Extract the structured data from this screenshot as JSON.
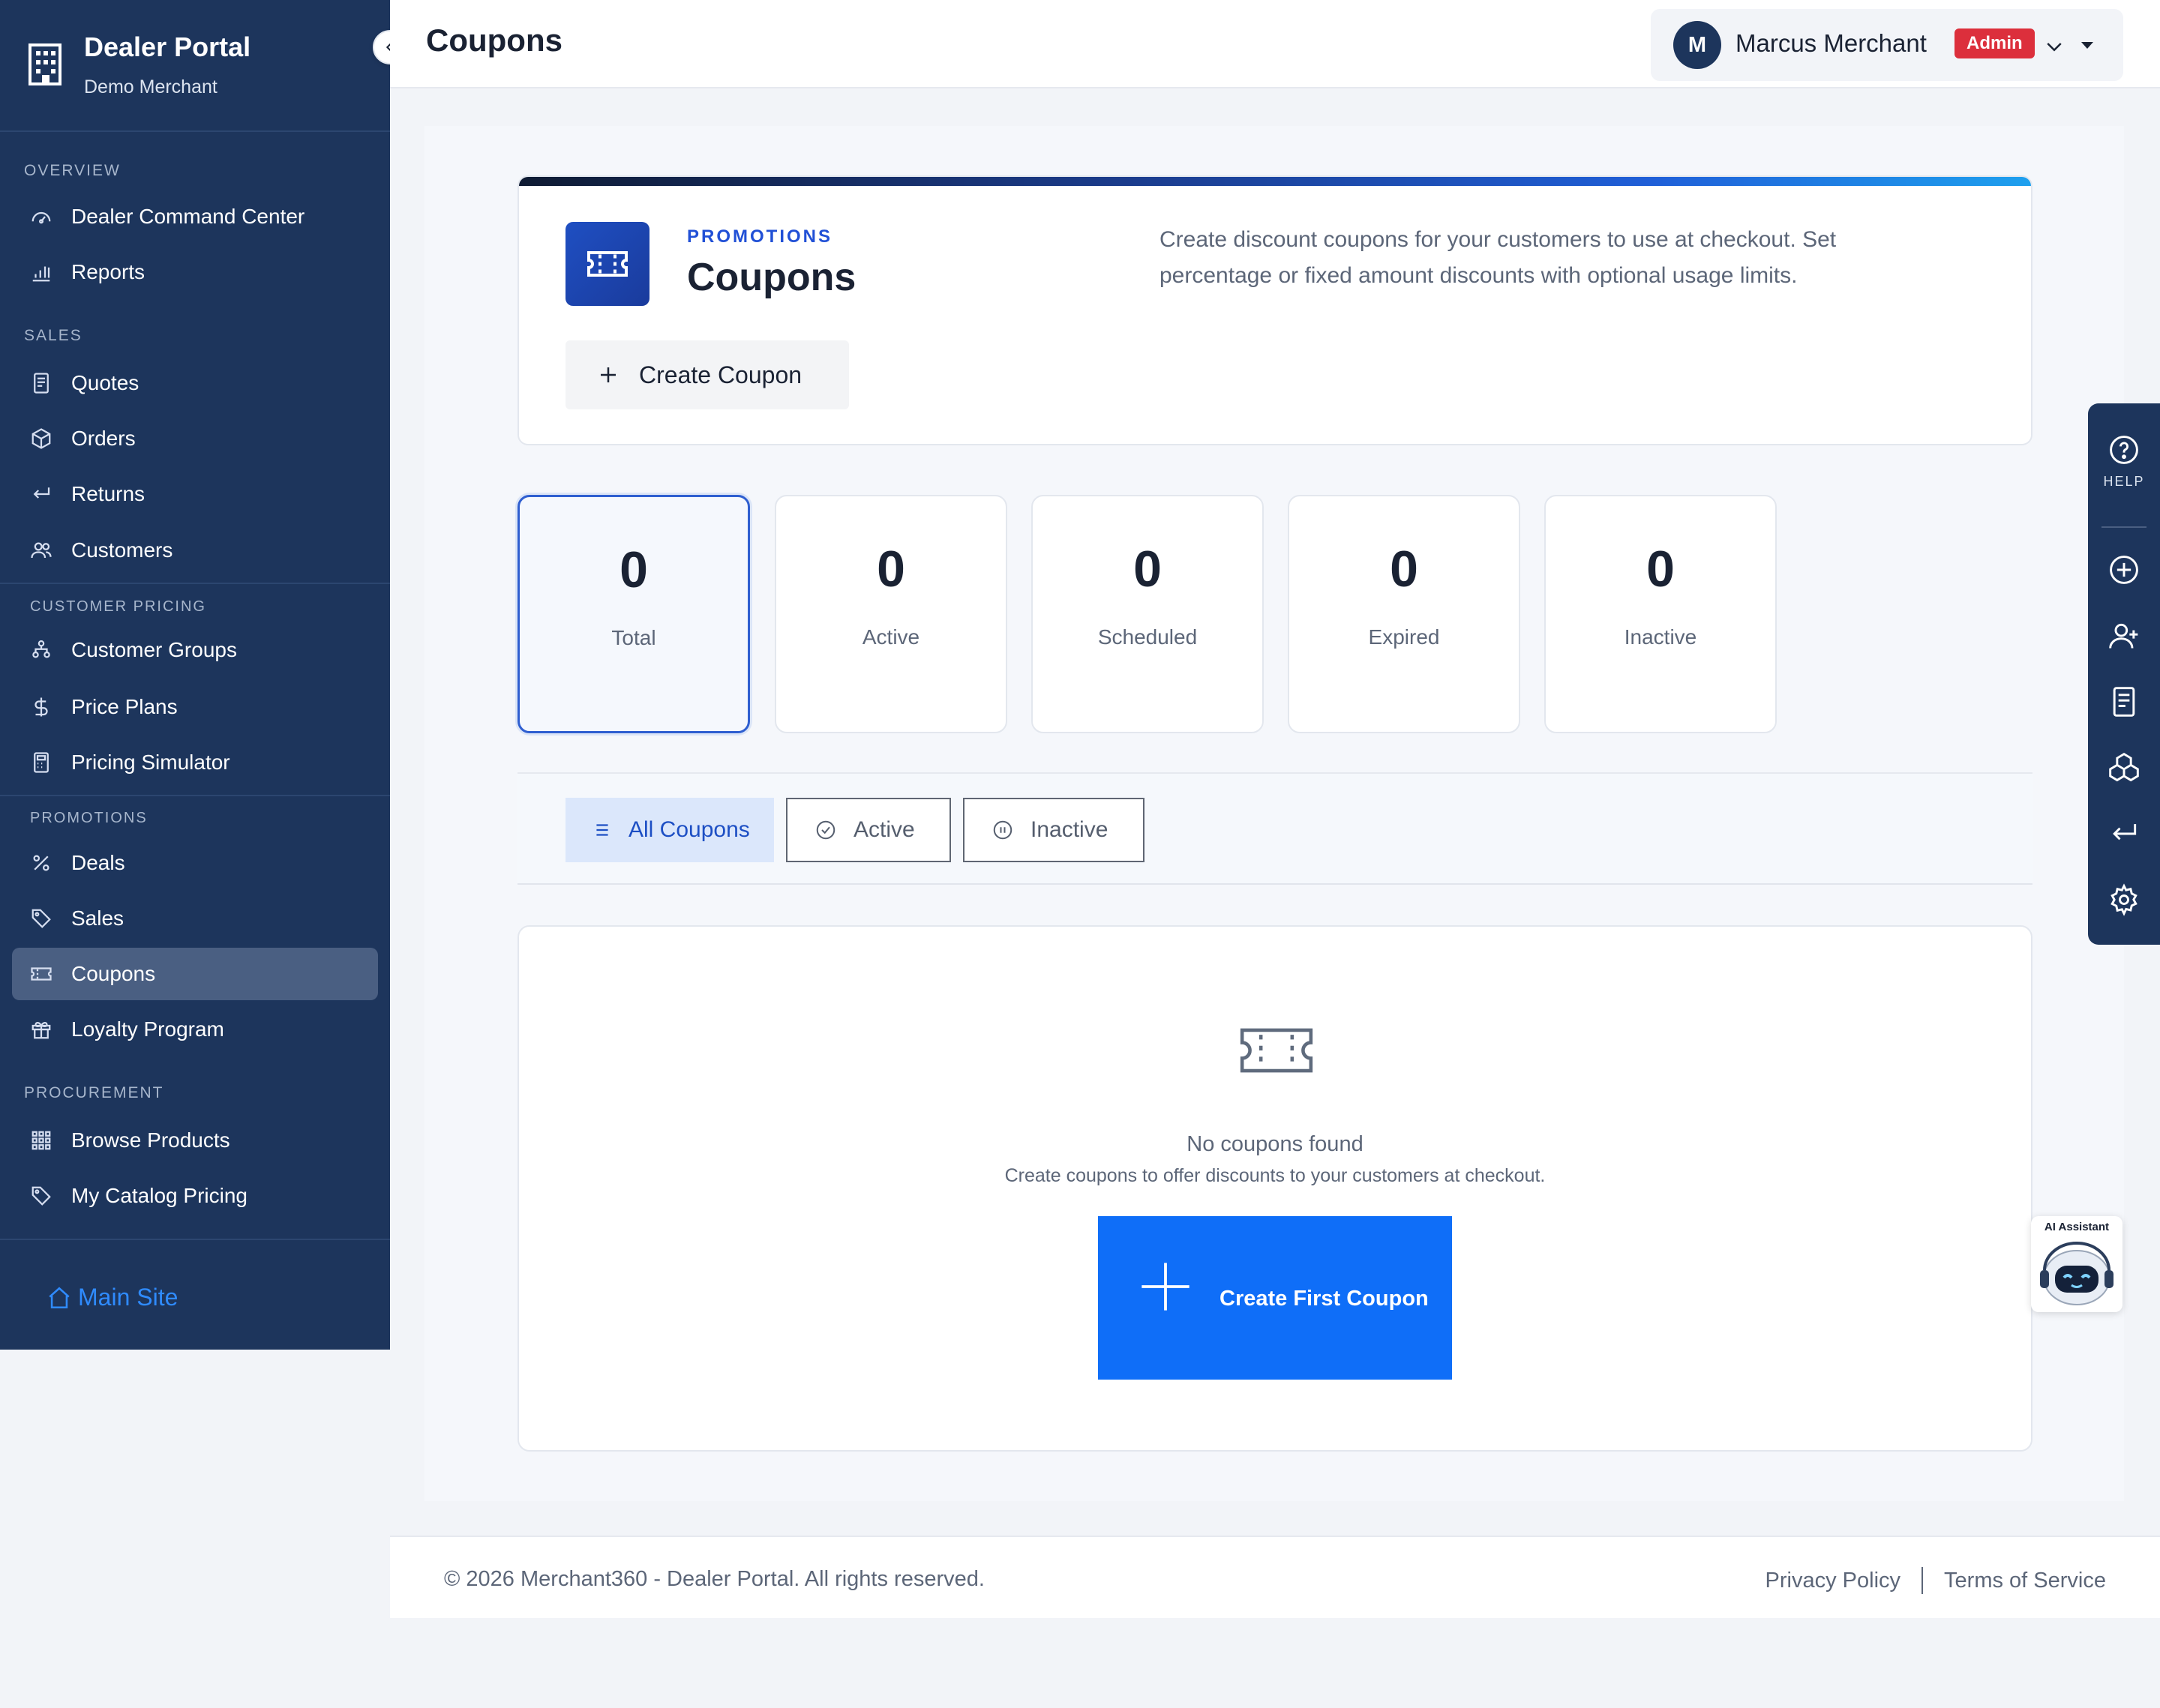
{
  "sidebar": {
    "brand_title": "Dealer Portal",
    "brand_subtitle": "Demo Merchant",
    "sections": {
      "overview": "OVERVIEW",
      "sales": "SALES",
      "customer_pricing": "CUSTOMER PRICING",
      "promotions": "PROMOTIONS",
      "procurement": "PROCUREMENT"
    },
    "items": {
      "dealer_command_center": "Dealer Command Center",
      "reports": "Reports",
      "quotes": "Quotes",
      "orders": "Orders",
      "returns": "Returns",
      "customers": "Customers",
      "customer_groups": "Customer Groups",
      "price_plans": "Price Plans",
      "pricing_simulator": "Pricing Simulator",
      "deals": "Deals",
      "sales": "Sales",
      "coupons": "Coupons",
      "loyalty_program": "Loyalty Program",
      "browse_products": "Browse Products",
      "my_catalog_pricing": "My Catalog Pricing"
    },
    "active_item": "coupons",
    "main_site": "Main Site"
  },
  "header": {
    "title": "Coupons",
    "user_initial": "M",
    "user_name": "Marcus Merchant",
    "role_badge": "Admin"
  },
  "hero": {
    "eyebrow": "PROMOTIONS",
    "title": "Coupons",
    "description": "Create discount coupons for your customers to use at checkout. Set percentage or fixed amount discounts with optional usage limits.",
    "create_button": "Create Coupon"
  },
  "stats": {
    "total": {
      "value": "0",
      "label": "Total"
    },
    "active": {
      "value": "0",
      "label": "Active"
    },
    "scheduled": {
      "value": "0",
      "label": "Scheduled"
    },
    "expired": {
      "value": "0",
      "label": "Expired"
    },
    "inactive": {
      "value": "0",
      "label": "Inactive"
    }
  },
  "filters": {
    "all": "All Coupons",
    "active": "Active",
    "inactive": "Inactive",
    "selected": "all"
  },
  "empty_state": {
    "title": "No coupons found",
    "subtitle": "Create coupons to offer discounts to your customers at checkout.",
    "button": "Create First Coupon"
  },
  "footer": {
    "copyright": "© 2026 Merchant360 - Dealer Portal. All rights reserved.",
    "privacy": "Privacy Policy",
    "terms": "Terms of Service"
  },
  "quickbar": {
    "help_label": "HELP",
    "icons": [
      "help-icon",
      "plus-circle-icon",
      "add-user-icon",
      "document-icon",
      "boxes-icon",
      "return-icon",
      "gear-icon"
    ]
  },
  "ai_assistant": {
    "label": "AI Assistant"
  },
  "colors": {
    "sidebar": "#1d355c",
    "accent": "#0f6ef8",
    "badge": "#dc2f3c",
    "link": "#2f8bff"
  }
}
